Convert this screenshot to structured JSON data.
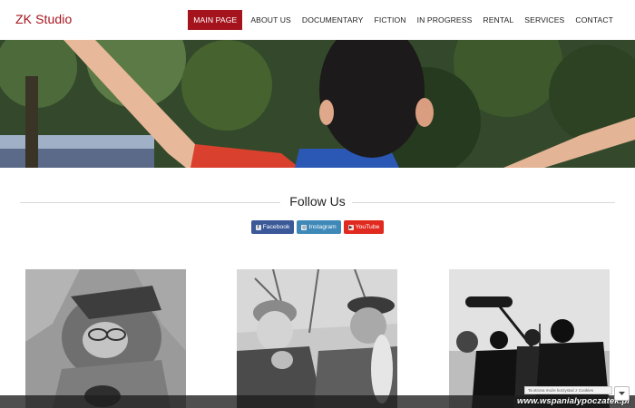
{
  "header": {
    "logo": "ZK Studio",
    "nav": [
      {
        "label": "MAIN PAGE",
        "active": true
      },
      {
        "label": "ABOUT US",
        "active": false
      },
      {
        "label": "DOCUMENTARY",
        "active": false
      },
      {
        "label": "FICTION",
        "active": false
      },
      {
        "label": "IN PROGRESS",
        "active": false
      },
      {
        "label": "RENTAL",
        "active": false
      },
      {
        "label": "SERVICES",
        "active": false
      },
      {
        "label": "CONTACT",
        "active": false
      }
    ]
  },
  "follow": {
    "title": "Follow Us",
    "buttons": [
      {
        "label": "Facebook",
        "icon": "facebook-icon",
        "color": "#3b5998"
      },
      {
        "label": "Instagram",
        "icon": "instagram-icon",
        "color": "#3f89b8"
      },
      {
        "label": "YouTube",
        "icon": "youtube-icon",
        "color": "#e02a20"
      }
    ]
  },
  "gallery": {
    "items": [
      {
        "name": "film-still-1"
      },
      {
        "name": "film-still-2"
      },
      {
        "name": "film-still-3"
      }
    ]
  },
  "cookie": {
    "text": "Ta strona może korzystać z Cookies"
  },
  "watermark": "www.wspanialypoczatek.pl",
  "colors": {
    "accent": "#a5141d",
    "facebook": "#3b5998",
    "instagram": "#3f89b8",
    "youtube": "#e02a20"
  }
}
